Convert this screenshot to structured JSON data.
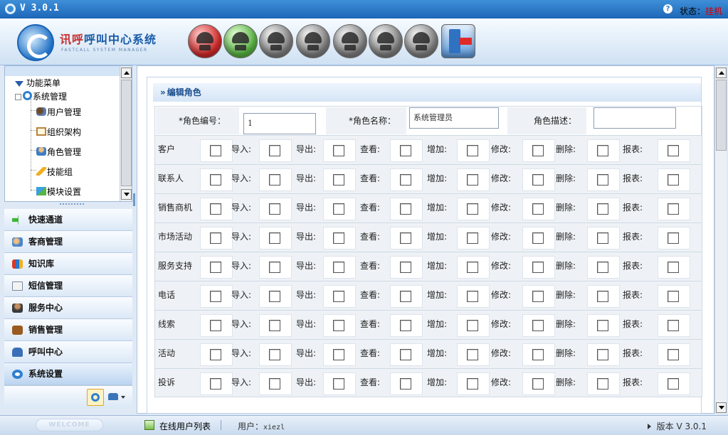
{
  "app": {
    "version": "V 3.0.1"
  },
  "status": {
    "label": "状态：",
    "value": "挂机"
  },
  "brand": {
    "name_red": "讯呼",
    "name_blue": "呼叫中心系统",
    "subtitle": "FASTCALL SYSTEM MANAGER"
  },
  "toolbar": {
    "icons": [
      "hangup-phone-icon",
      "answer-phone-icon",
      "phone-icon",
      "dial-icon",
      "transfer-icon",
      "mute-icon",
      "hold-icon",
      "exit-door-icon"
    ]
  },
  "tree": {
    "root": "功能菜单",
    "group": "系统管理",
    "items": [
      "用户管理",
      "组织架构",
      "角色管理",
      "技能组",
      "模块设置"
    ]
  },
  "nav": {
    "items": [
      {
        "label": "快速通道",
        "icon": "green-arrow-icon"
      },
      {
        "label": "客商管理",
        "icon": "customers-icon"
      },
      {
        "label": "知识库",
        "icon": "books-icon"
      },
      {
        "label": "短信管理",
        "icon": "envelope-icon"
      },
      {
        "label": "服务中心",
        "icon": "agent-icon"
      },
      {
        "label": "销售管理",
        "icon": "briefcase-icon"
      },
      {
        "label": "呼叫中心",
        "icon": "telephone-icon"
      },
      {
        "label": "系统设置",
        "icon": "gear-icon"
      }
    ],
    "active": "系统设置"
  },
  "panel": {
    "title": "编辑角色",
    "fields": {
      "role_id_label": "*角色编号：",
      "role_id_value": "1",
      "role_name_label": "*角色名称：",
      "role_name_value": "系统管理员",
      "role_desc_label": "角色描述：",
      "role_desc_value": ""
    },
    "permission_labels": [
      "导入:",
      "导出:",
      "查看:",
      "增加:",
      "修改:",
      "删除:",
      "报表:"
    ],
    "modules": [
      "客户",
      "联系人",
      "销售商机",
      "市场活动",
      "服务支持",
      "电话",
      "线索",
      "活动",
      "投诉"
    ]
  },
  "statusbar": {
    "welcome": "WELCOME",
    "online_users": "在线用户列表",
    "user_label": "用户：",
    "user_value": "xiezl",
    "version": "版本 V 3.0.1"
  }
}
